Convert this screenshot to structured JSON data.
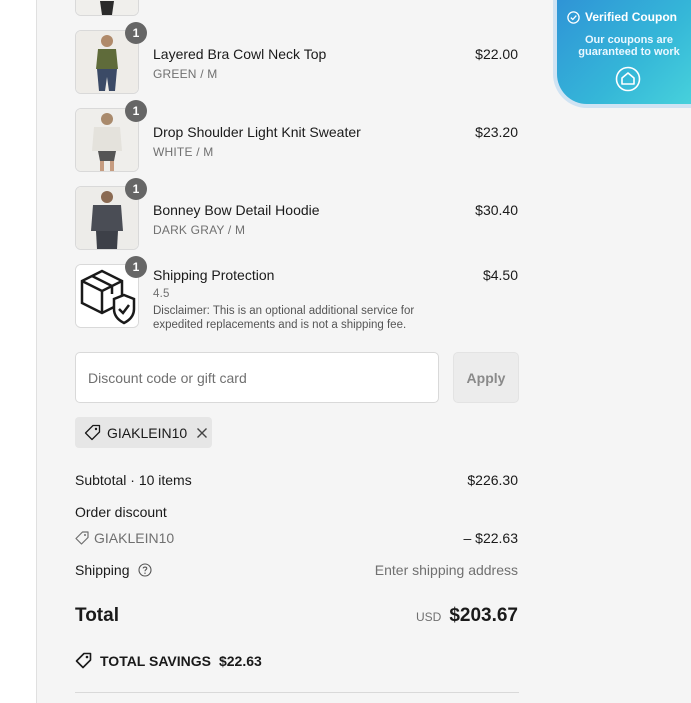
{
  "items": [
    {
      "name": "Layered Bra Cowl Neck Top",
      "variant": "GREEN / M",
      "price": "$22.00",
      "qty": "1",
      "color": "#5f6b3a"
    },
    {
      "name": "Drop Shoulder Light Knit Sweater",
      "variant": "WHITE / M",
      "price": "$23.20",
      "qty": "1",
      "color": "#e8e6e1"
    },
    {
      "name": "Bonney Bow Detail Hoodie",
      "variant": "DARK GRAY / M",
      "price": "$30.40",
      "qty": "1",
      "color": "#4a4d55"
    }
  ],
  "protection": {
    "name": "Shipping Protection",
    "rating": "4.5",
    "disclaimer": "Disclaimer: This is an optional additional service for expedited replacements and is not a shipping fee.",
    "price": "$4.50",
    "qty": "1"
  },
  "discount": {
    "placeholder": "Discount code or gift card",
    "apply_label": "Apply",
    "applied_code": "GIAKLEIN10"
  },
  "summary": {
    "subtotal_label": "Subtotal · 10 items",
    "subtotal_value": "$226.30",
    "order_discount_label": "Order discount",
    "discount_code": "GIAKLEIN10",
    "discount_value": "– $22.63",
    "shipping_label": "Shipping",
    "shipping_value": "Enter shipping address",
    "total_label": "Total",
    "currency": "USD",
    "total_value": "$203.67",
    "savings_label": "TOTAL SAVINGS",
    "savings_value": "$22.63"
  },
  "coupon_widget": {
    "title": "Verified Coupon",
    "subtitle": "Our coupons are guaranteed to work"
  },
  "colors": {
    "badge": "#666666",
    "summary_bg": "#f5f5f5",
    "widget_gradient_start": "#2e8fd6",
    "widget_gradient_end": "#49d4dc"
  }
}
